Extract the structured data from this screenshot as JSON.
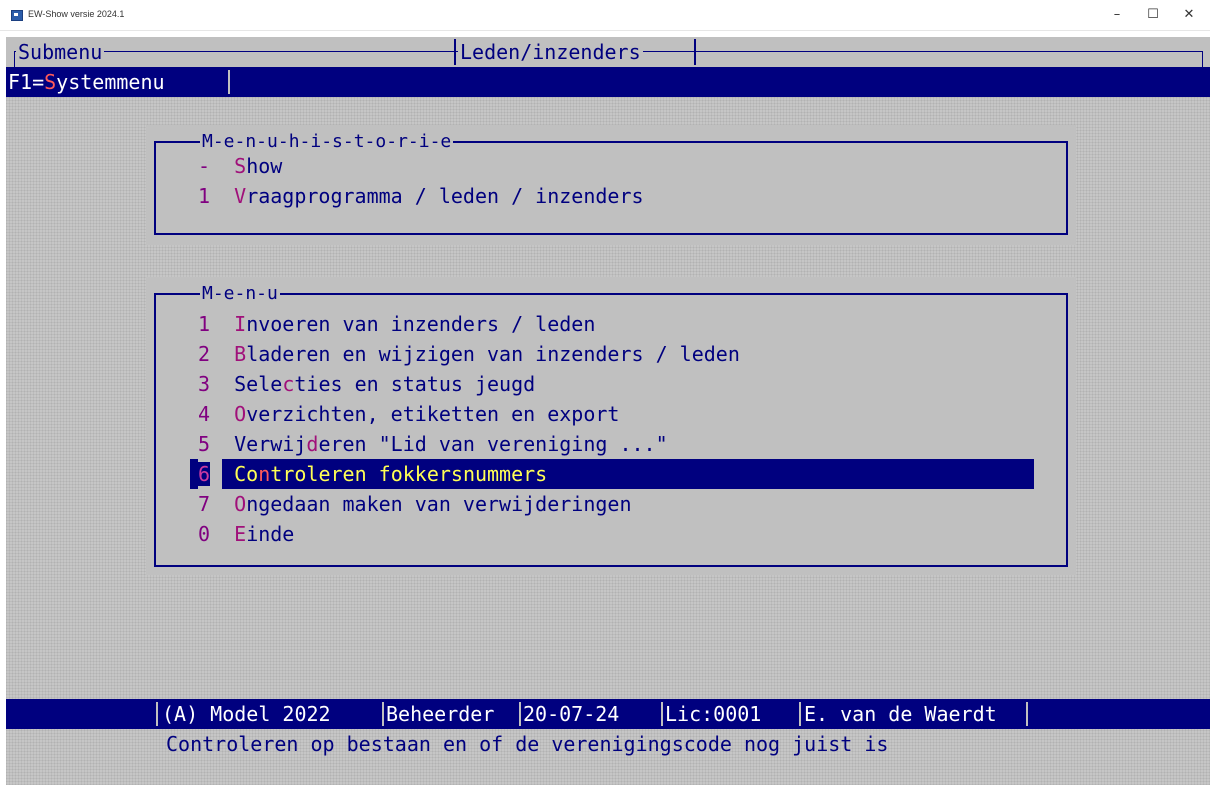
{
  "window": {
    "title": "EW-Show versie 2024.1",
    "minimize_glyph": "–",
    "maximize_glyph": "☐",
    "close_glyph": "✕"
  },
  "header": {
    "submenu_label": "Submenu",
    "section_title": "Leden/inzenders"
  },
  "menubar": {
    "f1_prefix": "F1=",
    "f1_hotkey": "S",
    "f1_rest": "ystemmenu"
  },
  "history": {
    "title": "M-e-n-u-h-i-s-t-o-r-i-e",
    "items": [
      {
        "num": "-",
        "hot": "S",
        "rest": "how"
      },
      {
        "num": "1",
        "hot": "V",
        "rest": "raagprogramma / leden / inzenders"
      }
    ]
  },
  "menu": {
    "title": "M-e-n-u",
    "items": [
      {
        "num": "1",
        "hot": "I",
        "rest": "nvoeren van inzenders / leden"
      },
      {
        "num": "2",
        "hot": "B",
        "rest": "laderen en wijzigen van inzenders / leden"
      },
      {
        "num": "3",
        "pre": "Sele",
        "hot": "c",
        "rest": "ties en status jeugd"
      },
      {
        "num": "4",
        "hot": "O",
        "rest": "verzichten, etiketten en export"
      },
      {
        "num": "5",
        "pre": "Verwij",
        "hot": "d",
        "rest": "eren \"Lid van vereniging ...\""
      },
      {
        "num": "6",
        "pre": "Co",
        "hot": "n",
        "rest": "troleren fokkersnummers",
        "selected": true
      },
      {
        "num": "7",
        "hot": "O",
        "rest": "ngedaan maken van verwijderingen"
      },
      {
        "num": "0",
        "hot": "E",
        "rest": "inde"
      }
    ]
  },
  "status": {
    "model": "(A) Model 2022",
    "role": "Beheerder",
    "date": "20-07-24",
    "license": "Lic:0001",
    "user": "E. van de Waerdt"
  },
  "hint": "Controleren op bestaan en of de verenigingscode nog juist is",
  "colors": {
    "screen_bg": "#c0c0c0",
    "bar_bg": "#00007f",
    "text": "#00007f",
    "hotkey": "#a0107a",
    "selected_text": "#ffff55"
  }
}
